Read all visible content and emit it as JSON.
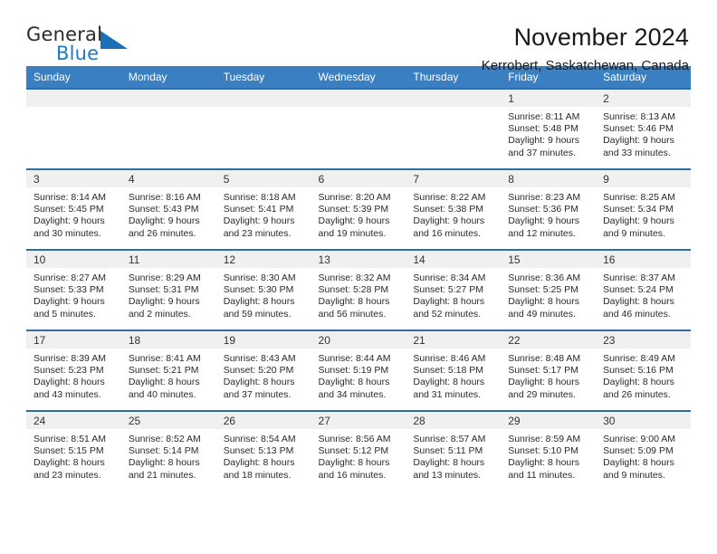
{
  "brand": {
    "name_part1": "General",
    "name_part2": "Blue",
    "accent_color": "#1f7ac4",
    "triangle_color": "#1a70b8"
  },
  "header": {
    "title": "November 2024",
    "subtitle": "Kerrobert, Saskatchewan, Canada"
  },
  "calendar": {
    "header_bg": "#3a7fc1",
    "row_divider_color": "#2e6da4",
    "daynum_band_bg": "#f0f0f0",
    "weekdays": [
      "Sunday",
      "Monday",
      "Tuesday",
      "Wednesday",
      "Thursday",
      "Friday",
      "Saturday"
    ],
    "weeks": [
      [
        {
          "day": "",
          "lines": []
        },
        {
          "day": "",
          "lines": []
        },
        {
          "day": "",
          "lines": []
        },
        {
          "day": "",
          "lines": []
        },
        {
          "day": "",
          "lines": []
        },
        {
          "day": "1",
          "lines": [
            "Sunrise: 8:11 AM",
            "Sunset: 5:48 PM",
            "Daylight: 9 hours",
            "and 37 minutes."
          ]
        },
        {
          "day": "2",
          "lines": [
            "Sunrise: 8:13 AM",
            "Sunset: 5:46 PM",
            "Daylight: 9 hours",
            "and 33 minutes."
          ]
        }
      ],
      [
        {
          "day": "3",
          "lines": [
            "Sunrise: 8:14 AM",
            "Sunset: 5:45 PM",
            "Daylight: 9 hours",
            "and 30 minutes."
          ]
        },
        {
          "day": "4",
          "lines": [
            "Sunrise: 8:16 AM",
            "Sunset: 5:43 PM",
            "Daylight: 9 hours",
            "and 26 minutes."
          ]
        },
        {
          "day": "5",
          "lines": [
            "Sunrise: 8:18 AM",
            "Sunset: 5:41 PM",
            "Daylight: 9 hours",
            "and 23 minutes."
          ]
        },
        {
          "day": "6",
          "lines": [
            "Sunrise: 8:20 AM",
            "Sunset: 5:39 PM",
            "Daylight: 9 hours",
            "and 19 minutes."
          ]
        },
        {
          "day": "7",
          "lines": [
            "Sunrise: 8:22 AM",
            "Sunset: 5:38 PM",
            "Daylight: 9 hours",
            "and 16 minutes."
          ]
        },
        {
          "day": "8",
          "lines": [
            "Sunrise: 8:23 AM",
            "Sunset: 5:36 PM",
            "Daylight: 9 hours",
            "and 12 minutes."
          ]
        },
        {
          "day": "9",
          "lines": [
            "Sunrise: 8:25 AM",
            "Sunset: 5:34 PM",
            "Daylight: 9 hours",
            "and 9 minutes."
          ]
        }
      ],
      [
        {
          "day": "10",
          "lines": [
            "Sunrise: 8:27 AM",
            "Sunset: 5:33 PM",
            "Daylight: 9 hours",
            "and 5 minutes."
          ]
        },
        {
          "day": "11",
          "lines": [
            "Sunrise: 8:29 AM",
            "Sunset: 5:31 PM",
            "Daylight: 9 hours",
            "and 2 minutes."
          ]
        },
        {
          "day": "12",
          "lines": [
            "Sunrise: 8:30 AM",
            "Sunset: 5:30 PM",
            "Daylight: 8 hours",
            "and 59 minutes."
          ]
        },
        {
          "day": "13",
          "lines": [
            "Sunrise: 8:32 AM",
            "Sunset: 5:28 PM",
            "Daylight: 8 hours",
            "and 56 minutes."
          ]
        },
        {
          "day": "14",
          "lines": [
            "Sunrise: 8:34 AM",
            "Sunset: 5:27 PM",
            "Daylight: 8 hours",
            "and 52 minutes."
          ]
        },
        {
          "day": "15",
          "lines": [
            "Sunrise: 8:36 AM",
            "Sunset: 5:25 PM",
            "Daylight: 8 hours",
            "and 49 minutes."
          ]
        },
        {
          "day": "16",
          "lines": [
            "Sunrise: 8:37 AM",
            "Sunset: 5:24 PM",
            "Daylight: 8 hours",
            "and 46 minutes."
          ]
        }
      ],
      [
        {
          "day": "17",
          "lines": [
            "Sunrise: 8:39 AM",
            "Sunset: 5:23 PM",
            "Daylight: 8 hours",
            "and 43 minutes."
          ]
        },
        {
          "day": "18",
          "lines": [
            "Sunrise: 8:41 AM",
            "Sunset: 5:21 PM",
            "Daylight: 8 hours",
            "and 40 minutes."
          ]
        },
        {
          "day": "19",
          "lines": [
            "Sunrise: 8:43 AM",
            "Sunset: 5:20 PM",
            "Daylight: 8 hours",
            "and 37 minutes."
          ]
        },
        {
          "day": "20",
          "lines": [
            "Sunrise: 8:44 AM",
            "Sunset: 5:19 PM",
            "Daylight: 8 hours",
            "and 34 minutes."
          ]
        },
        {
          "day": "21",
          "lines": [
            "Sunrise: 8:46 AM",
            "Sunset: 5:18 PM",
            "Daylight: 8 hours",
            "and 31 minutes."
          ]
        },
        {
          "day": "22",
          "lines": [
            "Sunrise: 8:48 AM",
            "Sunset: 5:17 PM",
            "Daylight: 8 hours",
            "and 29 minutes."
          ]
        },
        {
          "day": "23",
          "lines": [
            "Sunrise: 8:49 AM",
            "Sunset: 5:16 PM",
            "Daylight: 8 hours",
            "and 26 minutes."
          ]
        }
      ],
      [
        {
          "day": "24",
          "lines": [
            "Sunrise: 8:51 AM",
            "Sunset: 5:15 PM",
            "Daylight: 8 hours",
            "and 23 minutes."
          ]
        },
        {
          "day": "25",
          "lines": [
            "Sunrise: 8:52 AM",
            "Sunset: 5:14 PM",
            "Daylight: 8 hours",
            "and 21 minutes."
          ]
        },
        {
          "day": "26",
          "lines": [
            "Sunrise: 8:54 AM",
            "Sunset: 5:13 PM",
            "Daylight: 8 hours",
            "and 18 minutes."
          ]
        },
        {
          "day": "27",
          "lines": [
            "Sunrise: 8:56 AM",
            "Sunset: 5:12 PM",
            "Daylight: 8 hours",
            "and 16 minutes."
          ]
        },
        {
          "day": "28",
          "lines": [
            "Sunrise: 8:57 AM",
            "Sunset: 5:11 PM",
            "Daylight: 8 hours",
            "and 13 minutes."
          ]
        },
        {
          "day": "29",
          "lines": [
            "Sunrise: 8:59 AM",
            "Sunset: 5:10 PM",
            "Daylight: 8 hours",
            "and 11 minutes."
          ]
        },
        {
          "day": "30",
          "lines": [
            "Sunrise: 9:00 AM",
            "Sunset: 5:09 PM",
            "Daylight: 8 hours",
            "and 9 minutes."
          ]
        }
      ]
    ]
  }
}
